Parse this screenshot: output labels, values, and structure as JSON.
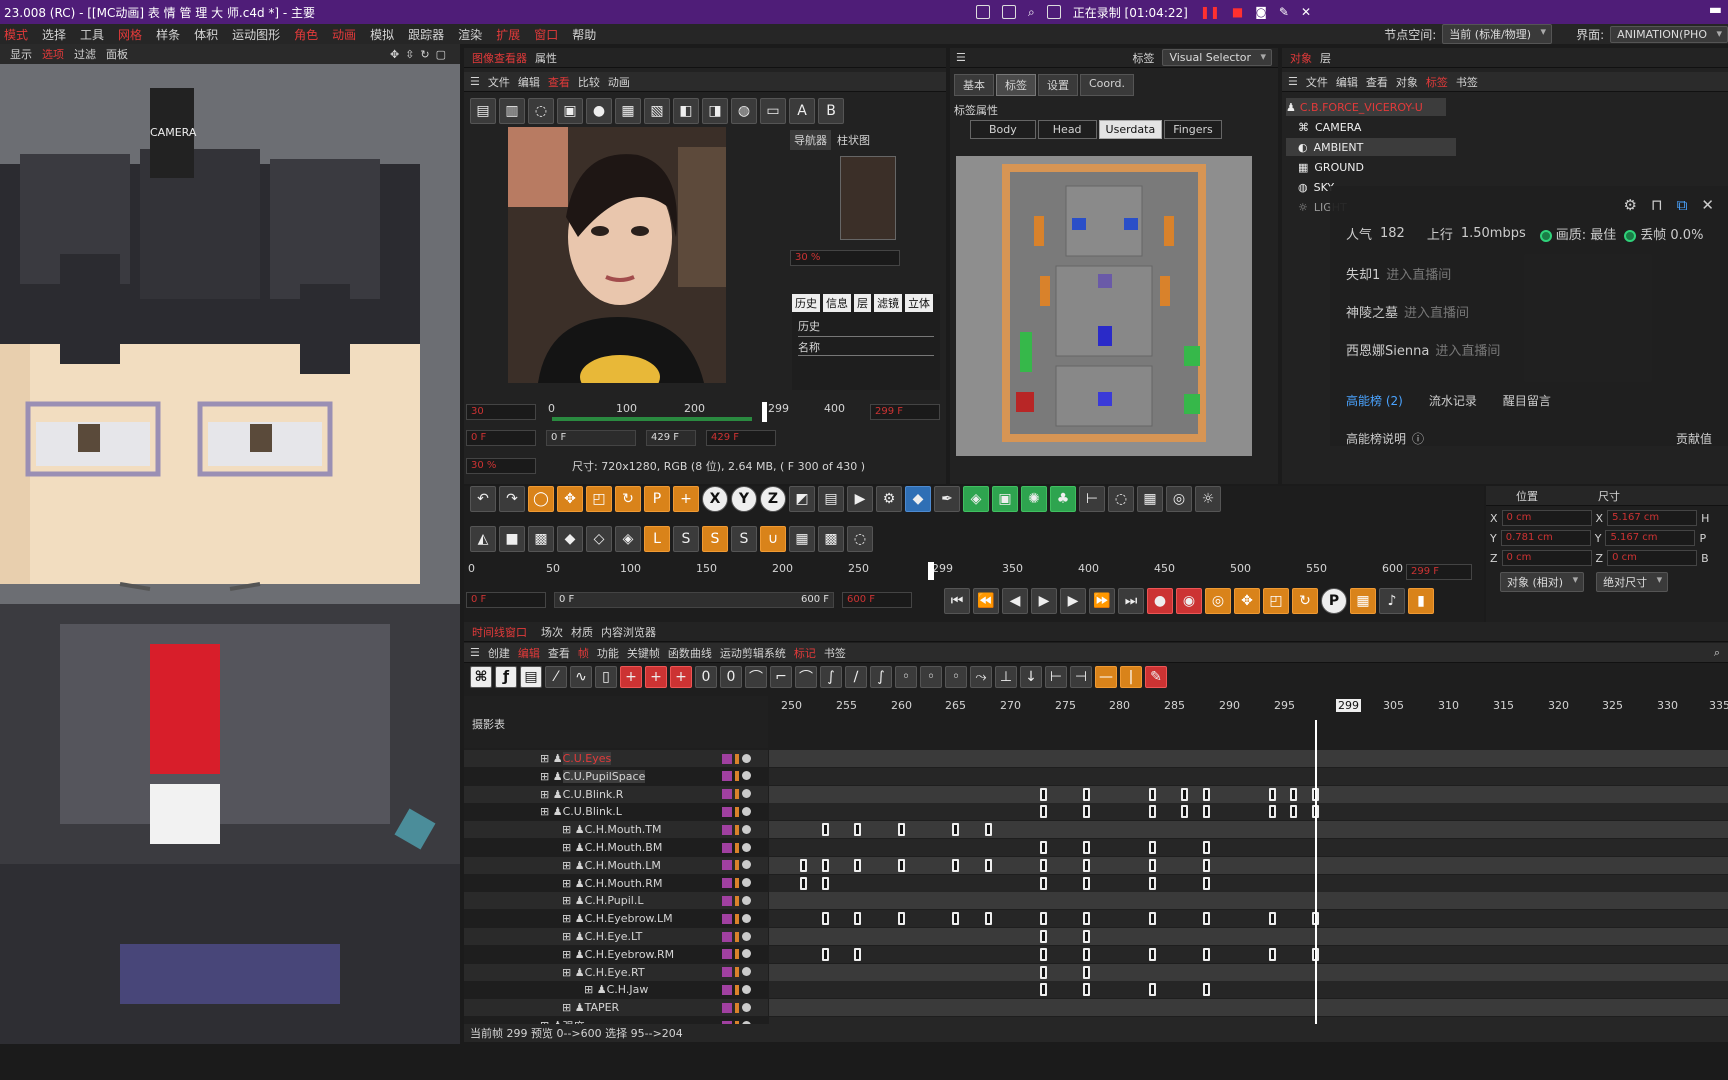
{
  "titlebar": {
    "title": "23.008 (RC) - [[MC动画] 表 情 管 理 大 师.c4d *] - 主要",
    "recording": "正在录制 [01:04:22]"
  },
  "menubar": {
    "items": [
      "模式",
      "选择",
      "工具",
      "网格",
      "样条",
      "体积",
      "运动图形",
      "角色",
      "动画",
      "模拟",
      "跟踪器",
      "渲染",
      "扩展",
      "窗口",
      "帮助"
    ],
    "node_space_label": "节点空间:",
    "node_space_value": "当前 (标准/物理)",
    "layout_label": "界面:",
    "layout_value": "ANIMATION(PHO"
  },
  "viewport": {
    "menu": [
      "显示",
      "选项",
      "过滤",
      "面板"
    ],
    "camera": "CAMERA",
    "colors": {
      "skin": "#f0dcbf",
      "hair": "#2a2a2e",
      "tie": "#d81e2a",
      "glasses": "#9a8fb4"
    }
  },
  "picture_viewer": {
    "tabs": [
      "图像查看器",
      "属性"
    ],
    "menu": [
      "文件",
      "编辑",
      "查看",
      "比较",
      "动画"
    ],
    "nav_tabs": [
      "导航器",
      "柱状图"
    ],
    "zoom": "30 %",
    "hist_tabs": [
      "历史",
      "信息",
      "层",
      "滤镜",
      "立体"
    ],
    "history_label": "历史",
    "name_label": "名称",
    "ruler": [
      "0",
      "100",
      "200",
      "299",
      "400"
    ],
    "frame_start": "0 F",
    "frame_a": "0 F",
    "frame_b": "429 F",
    "frame_c": "429 F",
    "frame_cur": "299 F",
    "field_30": "30",
    "zoom2": "30 %",
    "info": "尺寸: 720x1280, RGB (8 位), 2.64 MB, ( F 300 of 430 )"
  },
  "tag_panel": {
    "tag_label": "标签",
    "selector": "Visual Selector",
    "tabs": [
      "基本",
      "标签",
      "设置",
      "Coord."
    ],
    "prop_label": "标签属性",
    "sub_tabs": [
      "Body",
      "Head",
      "Userdata",
      "Fingers"
    ]
  },
  "outliner": {
    "tabs": [
      "对象",
      "层"
    ],
    "menu": [
      "文件",
      "编辑",
      "查看",
      "对象",
      "标签",
      "书签"
    ],
    "items": [
      "C.B.FORCE_VICEROY-U",
      "CAMERA",
      "AMBIENT",
      "GROUND",
      "SKY",
      "LIGHT"
    ]
  },
  "live_overlay": {
    "popularity_label": "人气",
    "popularity": "182",
    "upload_label": "上行",
    "upload": "1.50mbps",
    "quality_label": "画质: 最佳",
    "drop_label": "丢帧 0.0%",
    "entries": [
      {
        "name": "失却1",
        "action": "进入直播间"
      },
      {
        "name": "神陵之墓",
        "action": "进入直播间"
      },
      {
        "name": "西恩娜Sienna",
        "action": "进入直播间"
      }
    ],
    "tabs": [
      "高能榜 (2)",
      "流水记录",
      "醒目留言"
    ],
    "rank_note": "高能榜说明",
    "contrib": "贡献值"
  },
  "coords": {
    "header": [
      "位置",
      "尺寸"
    ],
    "rows": [
      {
        "axis": "X",
        "pos": "0 cm",
        "axis2": "X",
        "size": "5.167 cm",
        "axis3": "H"
      },
      {
        "axis": "Y",
        "pos": "0.781 cm",
        "axis2": "Y",
        "size": "5.167 cm",
        "axis3": "P"
      },
      {
        "axis": "Z",
        "pos": "0 cm",
        "axis2": "Z",
        "size": "0 cm",
        "axis3": "B"
      }
    ],
    "mode_a": "对象 (相对)",
    "mode_b": "绝对尺寸"
  },
  "powerslider": {
    "ruler": [
      "0",
      "50",
      "100",
      "150",
      "200",
      "250",
      "299",
      "350",
      "400",
      "450",
      "500",
      "550",
      "600"
    ],
    "start": "0 F",
    "range_a": "0 F",
    "range_b": "600 F",
    "end": "600 F",
    "current": "299 F"
  },
  "timeline": {
    "tabs": [
      "时间线窗口",
      "场次",
      "材质",
      "内容浏览器"
    ],
    "menu": [
      "创建",
      "编辑",
      "帧",
      "查看",
      "功能",
      "关键帧",
      "函数曲线",
      "运动剪辑系统",
      "标记",
      "书签"
    ],
    "sheet_label": "摄影表",
    "ruler": [
      "250",
      "255",
      "260",
      "265",
      "270",
      "275",
      "280",
      "285",
      "290",
      "295",
      "299",
      "305",
      "310",
      "315",
      "320",
      "325",
      "330",
      "335"
    ],
    "tracks": [
      {
        "name": "C.U.Eyes",
        "indent": 2
      },
      {
        "name": "C.U.PupilSpace",
        "indent": 2
      },
      {
        "name": "C.U.Blink.R",
        "indent": 2
      },
      {
        "name": "C.U.Blink.L",
        "indent": 2
      },
      {
        "name": "C.H.Mouth.TM",
        "indent": 1
      },
      {
        "name": "C.H.Mouth.BM",
        "indent": 1
      },
      {
        "name": "C.H.Mouth.LM",
        "indent": 1
      },
      {
        "name": "C.H.Mouth.RM",
        "indent": 1
      },
      {
        "name": "C.H.Pupil.L",
        "indent": 1
      },
      {
        "name": "C.H.Eyebrow.LM",
        "indent": 1
      },
      {
        "name": "C.H.Eye.LT",
        "indent": 1
      },
      {
        "name": "C.H.Eyebrow.RM",
        "indent": 1
      },
      {
        "name": "C.H.Eye.RT",
        "indent": 1
      },
      {
        "name": "C.H.Jaw",
        "indent": 0
      },
      {
        "name": "TAPER",
        "indent": 1
      },
      {
        "name": "强度",
        "indent": 2
      }
    ],
    "keys": [
      [],
      [],
      [
        274,
        278,
        284,
        287,
        289,
        295,
        297,
        299
      ],
      [
        274,
        278,
        284,
        287,
        289,
        295,
        297,
        299
      ],
      [
        254,
        257,
        261,
        266,
        269
      ],
      [
        274,
        278,
        284,
        289
      ],
      [
        252,
        254,
        257,
        261,
        266,
        269,
        274,
        278,
        284,
        289
      ],
      [
        252,
        254,
        274,
        278,
        284,
        289
      ],
      [],
      [
        254,
        257,
        261,
        266,
        269,
        274,
        278,
        284,
        289,
        295,
        299
      ],
      [
        274,
        278
      ],
      [
        254,
        257,
        274,
        278,
        284,
        289,
        295,
        299
      ],
      [
        274,
        278
      ],
      [
        274,
        278,
        284,
        289
      ],
      [],
      []
    ],
    "status": "当前帧  299  预览  0-->600   选择 95-->204"
  }
}
